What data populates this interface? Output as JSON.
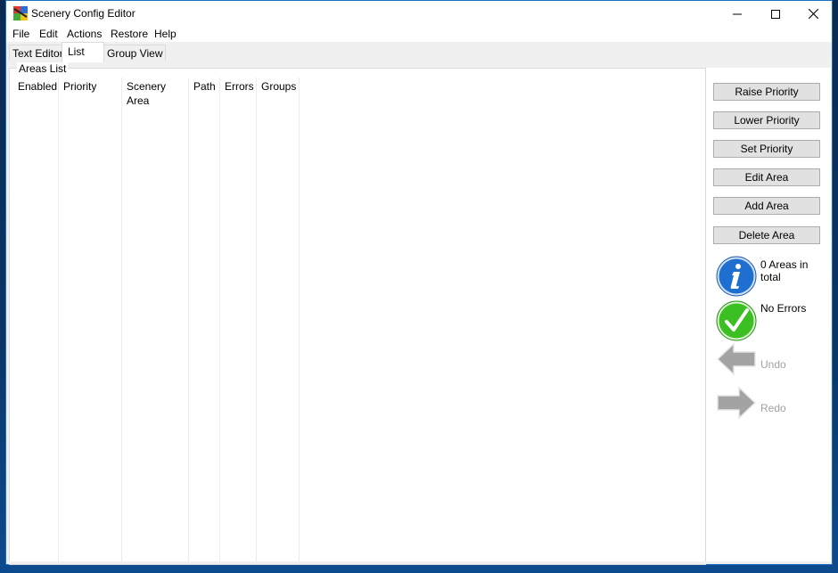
{
  "window": {
    "title": "Scenery Config Editor",
    "controls": {
      "minimize": "minimize",
      "maximize": "maximize",
      "close": "close"
    }
  },
  "menu": {
    "items": [
      "File",
      "Edit",
      "Actions",
      "Restore",
      "Help"
    ]
  },
  "tabs": [
    {
      "label": "Text Editor",
      "active": false
    },
    {
      "label": "List",
      "active": true
    },
    {
      "label": "Group View",
      "active": false
    }
  ],
  "areas_list": {
    "group_label": "Areas List",
    "columns": [
      "Enabled",
      "Priority",
      "Scenery Area",
      "Path",
      "Errors",
      "Groups"
    ],
    "rows": []
  },
  "actions": {
    "raise_priority": "Raise Priority",
    "lower_priority": "Lower Priority",
    "set_priority": "Set Priority",
    "edit_area": "Edit Area",
    "add_area": "Add Area",
    "delete_area": "Delete Area"
  },
  "status": {
    "areas_total": "0 Areas in total",
    "errors": "No Errors",
    "undo": "Undo",
    "redo": "Redo"
  },
  "colors": {
    "info_blue": "#1e6fd0",
    "ok_green": "#3bbf22",
    "disabled_gray": "#a0a0a0"
  }
}
